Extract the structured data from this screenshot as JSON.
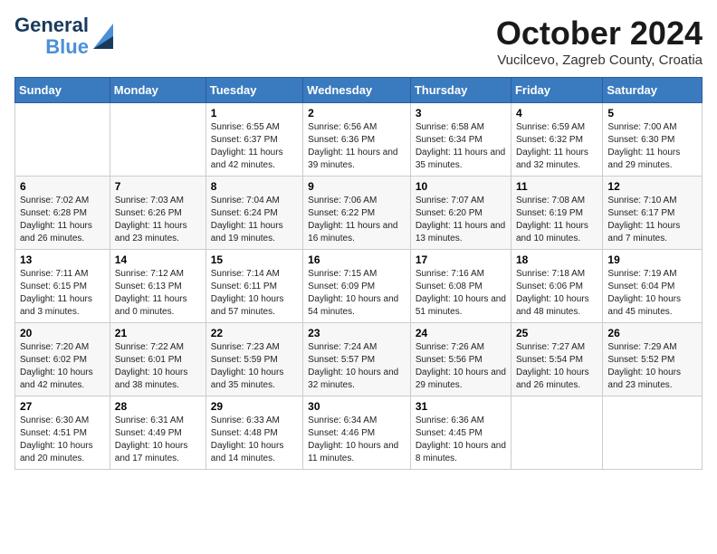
{
  "header": {
    "logo_line1": "General",
    "logo_line2": "Blue",
    "month_title": "October 2024",
    "location": "Vucilcevo, Zagreb County, Croatia"
  },
  "days_of_week": [
    "Sunday",
    "Monday",
    "Tuesday",
    "Wednesday",
    "Thursday",
    "Friday",
    "Saturday"
  ],
  "weeks": [
    [
      {
        "day": "",
        "details": ""
      },
      {
        "day": "",
        "details": ""
      },
      {
        "day": "1",
        "details": "Sunrise: 6:55 AM\nSunset: 6:37 PM\nDaylight: 11 hours and 42 minutes."
      },
      {
        "day": "2",
        "details": "Sunrise: 6:56 AM\nSunset: 6:36 PM\nDaylight: 11 hours and 39 minutes."
      },
      {
        "day": "3",
        "details": "Sunrise: 6:58 AM\nSunset: 6:34 PM\nDaylight: 11 hours and 35 minutes."
      },
      {
        "day": "4",
        "details": "Sunrise: 6:59 AM\nSunset: 6:32 PM\nDaylight: 11 hours and 32 minutes."
      },
      {
        "day": "5",
        "details": "Sunrise: 7:00 AM\nSunset: 6:30 PM\nDaylight: 11 hours and 29 minutes."
      }
    ],
    [
      {
        "day": "6",
        "details": "Sunrise: 7:02 AM\nSunset: 6:28 PM\nDaylight: 11 hours and 26 minutes."
      },
      {
        "day": "7",
        "details": "Sunrise: 7:03 AM\nSunset: 6:26 PM\nDaylight: 11 hours and 23 minutes."
      },
      {
        "day": "8",
        "details": "Sunrise: 7:04 AM\nSunset: 6:24 PM\nDaylight: 11 hours and 19 minutes."
      },
      {
        "day": "9",
        "details": "Sunrise: 7:06 AM\nSunset: 6:22 PM\nDaylight: 11 hours and 16 minutes."
      },
      {
        "day": "10",
        "details": "Sunrise: 7:07 AM\nSunset: 6:20 PM\nDaylight: 11 hours and 13 minutes."
      },
      {
        "day": "11",
        "details": "Sunrise: 7:08 AM\nSunset: 6:19 PM\nDaylight: 11 hours and 10 minutes."
      },
      {
        "day": "12",
        "details": "Sunrise: 7:10 AM\nSunset: 6:17 PM\nDaylight: 11 hours and 7 minutes."
      }
    ],
    [
      {
        "day": "13",
        "details": "Sunrise: 7:11 AM\nSunset: 6:15 PM\nDaylight: 11 hours and 3 minutes."
      },
      {
        "day": "14",
        "details": "Sunrise: 7:12 AM\nSunset: 6:13 PM\nDaylight: 11 hours and 0 minutes."
      },
      {
        "day": "15",
        "details": "Sunrise: 7:14 AM\nSunset: 6:11 PM\nDaylight: 10 hours and 57 minutes."
      },
      {
        "day": "16",
        "details": "Sunrise: 7:15 AM\nSunset: 6:09 PM\nDaylight: 10 hours and 54 minutes."
      },
      {
        "day": "17",
        "details": "Sunrise: 7:16 AM\nSunset: 6:08 PM\nDaylight: 10 hours and 51 minutes."
      },
      {
        "day": "18",
        "details": "Sunrise: 7:18 AM\nSunset: 6:06 PM\nDaylight: 10 hours and 48 minutes."
      },
      {
        "day": "19",
        "details": "Sunrise: 7:19 AM\nSunset: 6:04 PM\nDaylight: 10 hours and 45 minutes."
      }
    ],
    [
      {
        "day": "20",
        "details": "Sunrise: 7:20 AM\nSunset: 6:02 PM\nDaylight: 10 hours and 42 minutes."
      },
      {
        "day": "21",
        "details": "Sunrise: 7:22 AM\nSunset: 6:01 PM\nDaylight: 10 hours and 38 minutes."
      },
      {
        "day": "22",
        "details": "Sunrise: 7:23 AM\nSunset: 5:59 PM\nDaylight: 10 hours and 35 minutes."
      },
      {
        "day": "23",
        "details": "Sunrise: 7:24 AM\nSunset: 5:57 PM\nDaylight: 10 hours and 32 minutes."
      },
      {
        "day": "24",
        "details": "Sunrise: 7:26 AM\nSunset: 5:56 PM\nDaylight: 10 hours and 29 minutes."
      },
      {
        "day": "25",
        "details": "Sunrise: 7:27 AM\nSunset: 5:54 PM\nDaylight: 10 hours and 26 minutes."
      },
      {
        "day": "26",
        "details": "Sunrise: 7:29 AM\nSunset: 5:52 PM\nDaylight: 10 hours and 23 minutes."
      }
    ],
    [
      {
        "day": "27",
        "details": "Sunrise: 6:30 AM\nSunset: 4:51 PM\nDaylight: 10 hours and 20 minutes."
      },
      {
        "day": "28",
        "details": "Sunrise: 6:31 AM\nSunset: 4:49 PM\nDaylight: 10 hours and 17 minutes."
      },
      {
        "day": "29",
        "details": "Sunrise: 6:33 AM\nSunset: 4:48 PM\nDaylight: 10 hours and 14 minutes."
      },
      {
        "day": "30",
        "details": "Sunrise: 6:34 AM\nSunset: 4:46 PM\nDaylight: 10 hours and 11 minutes."
      },
      {
        "day": "31",
        "details": "Sunrise: 6:36 AM\nSunset: 4:45 PM\nDaylight: 10 hours and 8 minutes."
      },
      {
        "day": "",
        "details": ""
      },
      {
        "day": "",
        "details": ""
      }
    ]
  ]
}
